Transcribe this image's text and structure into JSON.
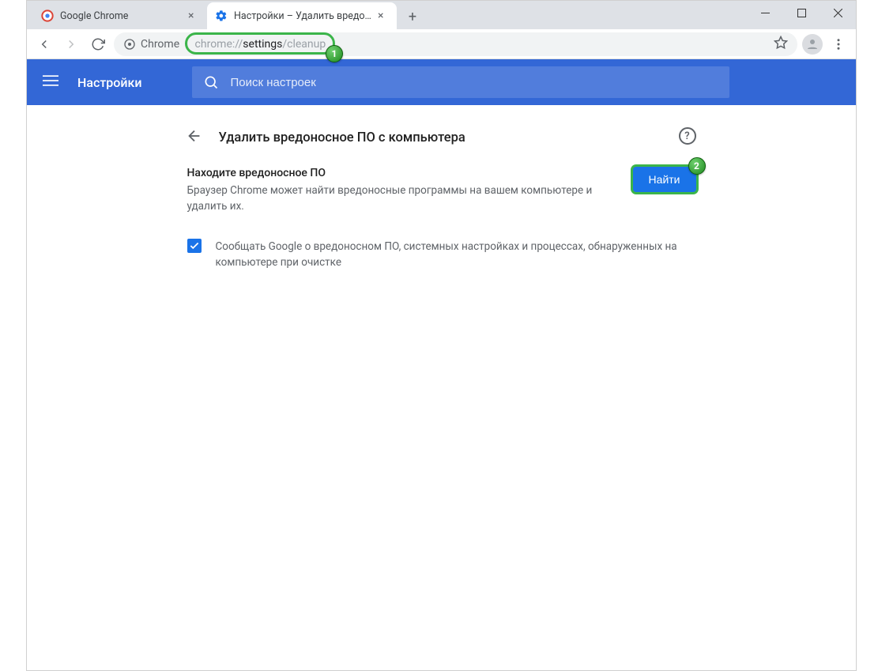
{
  "window": {
    "tabs": [
      {
        "title": "Google Chrome",
        "active": false
      },
      {
        "title": "Настройки – Удалить вредонос",
        "active": true
      }
    ]
  },
  "toolbar": {
    "site_chip": "Chrome",
    "url_prefix": "chrome://",
    "url_bold": "settings",
    "url_suffix": "/cleanup"
  },
  "settings": {
    "app_title": "Настройки",
    "search_placeholder": "Поиск настроек",
    "page_heading": "Удалить вредоносное ПО с компьютера",
    "section": {
      "title": "Находите вредоносное ПО",
      "description": "Браузер Chrome может найти вредоносные программы на вашем компьютере и удалить их.",
      "find_button": "Найти"
    },
    "checkbox": {
      "checked": true,
      "label": "Сообщать Google о вредоносном ПО, системных настройках и процессах, обнаруженных на компьютере при очистке"
    }
  },
  "annotations": {
    "badge1": "1",
    "badge2": "2"
  }
}
